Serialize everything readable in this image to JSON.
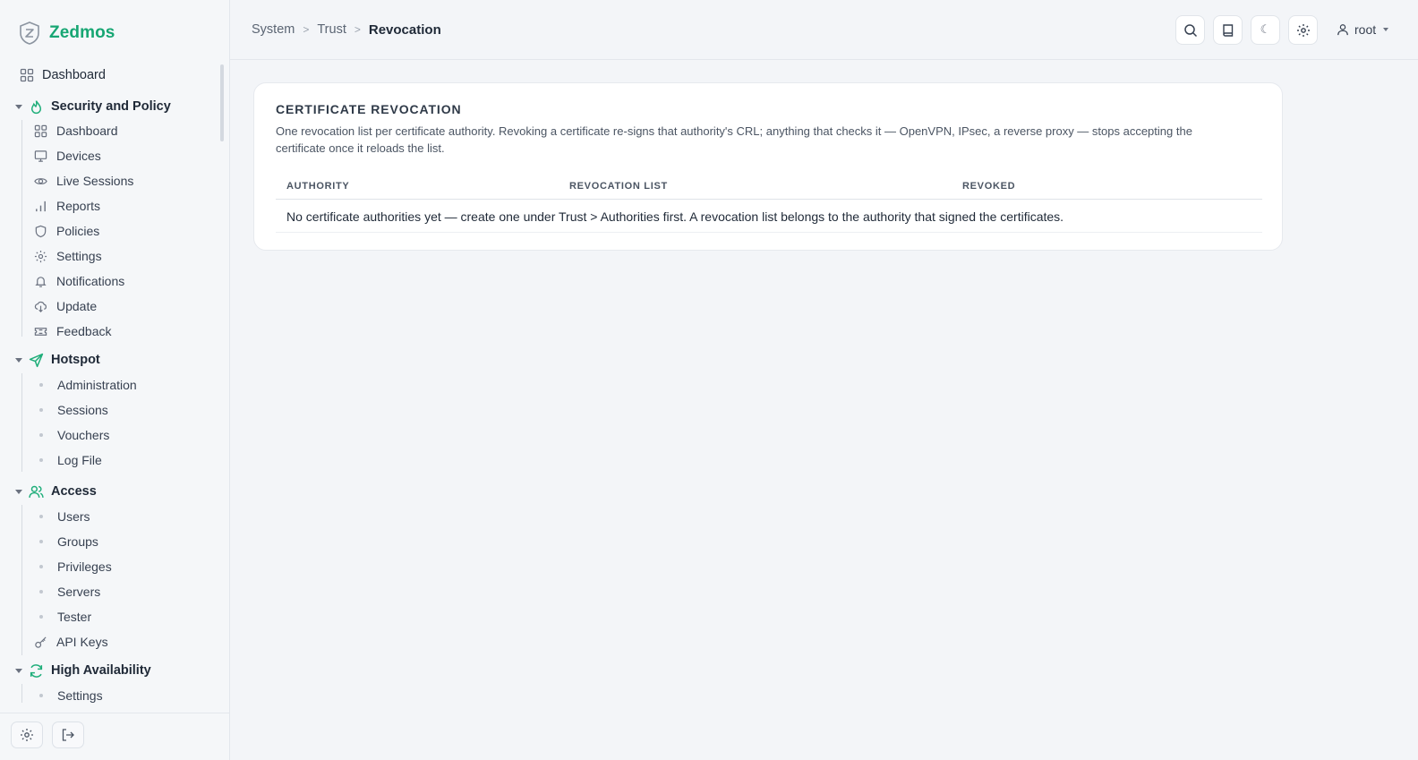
{
  "brand": {
    "name": "Zedmos"
  },
  "sidebar": {
    "top_item": {
      "label": "Dashboard",
      "icon": "grid-icon"
    },
    "groups": [
      {
        "label": "Security and Policy",
        "icon": "flame-icon",
        "items": [
          {
            "label": "Dashboard",
            "icon": "grid-icon"
          },
          {
            "label": "Devices",
            "icon": "monitor-icon"
          },
          {
            "label": "Live Sessions",
            "icon": "eye-icon"
          },
          {
            "label": "Reports",
            "icon": "bar-chart-icon"
          },
          {
            "label": "Policies",
            "icon": "shield-icon"
          },
          {
            "label": "Settings",
            "icon": "gear-icon"
          },
          {
            "label": "Notifications",
            "icon": "bell-icon"
          },
          {
            "label": "Update",
            "icon": "cloud-download-icon"
          },
          {
            "label": "Feedback",
            "icon": "ticket-icon"
          }
        ]
      },
      {
        "label": "Hotspot",
        "icon": "send-icon",
        "items": [
          {
            "label": "Administration"
          },
          {
            "label": "Sessions"
          },
          {
            "label": "Vouchers"
          },
          {
            "label": "Log File"
          }
        ]
      },
      {
        "label": "Access",
        "icon": "users-icon",
        "items": [
          {
            "label": "Users"
          },
          {
            "label": "Groups"
          },
          {
            "label": "Privileges"
          },
          {
            "label": "Servers"
          },
          {
            "label": "Tester"
          },
          {
            "label": "API Keys",
            "icon": "key-icon"
          }
        ]
      },
      {
        "label": "High Availability",
        "icon": "refresh-icon",
        "items": [
          {
            "label": "Settings"
          }
        ]
      }
    ]
  },
  "header": {
    "breadcrumb": [
      "System",
      "Trust"
    ],
    "current": "Revocation",
    "user": "root",
    "theme_glyph": "☾"
  },
  "card": {
    "title": "CERTIFICATE REVOCATION",
    "description": "One revocation list per certificate authority. Revoking a certificate re-signs that authority's CRL; anything that checks it — OpenVPN, IPsec, a reverse proxy — stops accepting the certificate once it reloads the list.",
    "columns": [
      "AUTHORITY",
      "REVOCATION LIST",
      "REVOKED"
    ],
    "empty_message": "No certificate authorities yet — create one under Trust > Authorities first. A revocation list belongs to the authority that signed the certificates."
  },
  "colors": {
    "brand": "#17a673",
    "accent_icon": "#1fae7a"
  }
}
